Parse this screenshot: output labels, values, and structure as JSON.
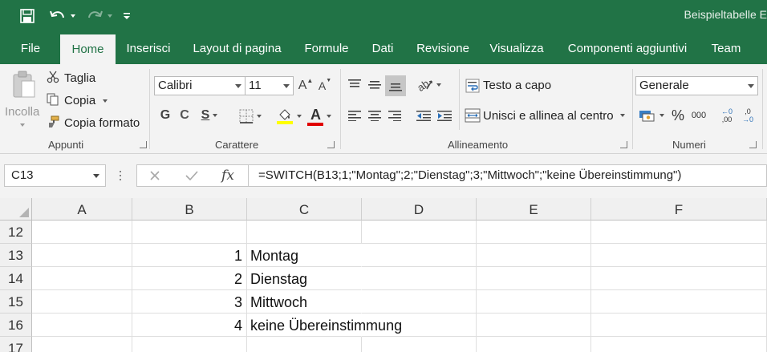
{
  "title_bar": {
    "doc_title": "Beispieltabelle E"
  },
  "colors": {
    "brand": "#217346",
    "ribbon_bg": "#f3f3f3"
  },
  "tabs": [
    {
      "label": "File"
    },
    {
      "label": "Home"
    },
    {
      "label": "Inserisci"
    },
    {
      "label": "Layout di pagina"
    },
    {
      "label": "Formule"
    },
    {
      "label": "Dati"
    },
    {
      "label": "Revisione"
    },
    {
      "label": "Visualizza"
    },
    {
      "label": "Componenti aggiuntivi"
    },
    {
      "label": "Team"
    }
  ],
  "ribbon": {
    "clipboard": {
      "paste_label": "Incolla",
      "cut_label": "Taglia",
      "copy_label": "Copia",
      "format_painter_label": "Copia formato",
      "group_label": "Appunti"
    },
    "font": {
      "font_name": "Calibri",
      "font_size": "11",
      "bold": "G",
      "italic": "C",
      "underline": "S",
      "grow_icon": "A",
      "shrink_icon": "A",
      "font_color_icon": "A",
      "group_label": "Carattere"
    },
    "alignment": {
      "wrap_label": "Testo a capo",
      "merge_label": "Unisci e allinea al centro",
      "group_label": "Allineamento"
    },
    "number": {
      "format": "Generale",
      "percent": "%",
      "thousands": "000",
      "inc_decimal": ",00",
      "group_label": "Numeri"
    }
  },
  "formula_bar": {
    "name_box": "C13",
    "fx": "fx",
    "formula": "=SWITCH(B13;1;\"Montag\";2;\"Dienstag\";3;\"Mittwoch\";\"keine Übereinstimmung\")"
  },
  "grid": {
    "columns": [
      "A",
      "B",
      "C",
      "D",
      "E",
      "F"
    ],
    "rows": [
      {
        "num": "12",
        "b": "",
        "c": ""
      },
      {
        "num": "13",
        "b": "1",
        "c": "Montag"
      },
      {
        "num": "14",
        "b": "2",
        "c": "Dienstag"
      },
      {
        "num": "15",
        "b": "3",
        "c": "Mittwoch"
      },
      {
        "num": "16",
        "b": "4",
        "c": "keine Übereinstimmung"
      },
      {
        "num": "17",
        "b": "",
        "c": ""
      }
    ]
  }
}
